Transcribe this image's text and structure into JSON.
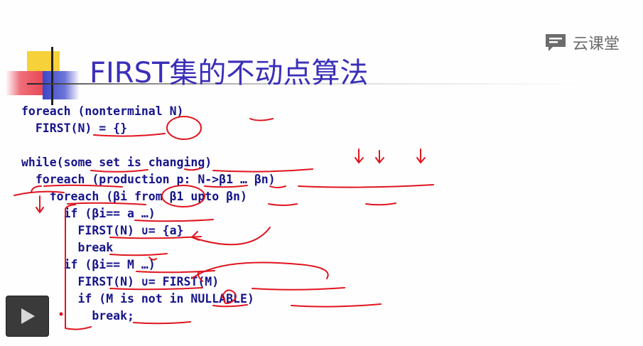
{
  "slide": {
    "title": "FIRST集的不动点算法",
    "brand": {
      "text": "云课堂",
      "icon": "speech-bubble-icon"
    }
  },
  "code_lines": [
    "foreach (nonterminal N)",
    "  FIRST(N) = {}",
    "while(some set is changing)",
    "  foreach (production p: N->β1 … βn)",
    "    foreach (βi from β1 upto βn)",
    "      if (βi== a …)",
    "        FIRST(N) ∪= {a}",
    "        break",
    "      if (βi== M …)",
    "        FIRST(N) ∪= FIRST(M)",
    "        if (M is not in NULLABLE)",
    "          break;"
  ],
  "player": {
    "play_icon": "play-icon"
  },
  "colors": {
    "title": "#3a2fb8",
    "code": "#16148a",
    "ink": "#e0151f"
  }
}
